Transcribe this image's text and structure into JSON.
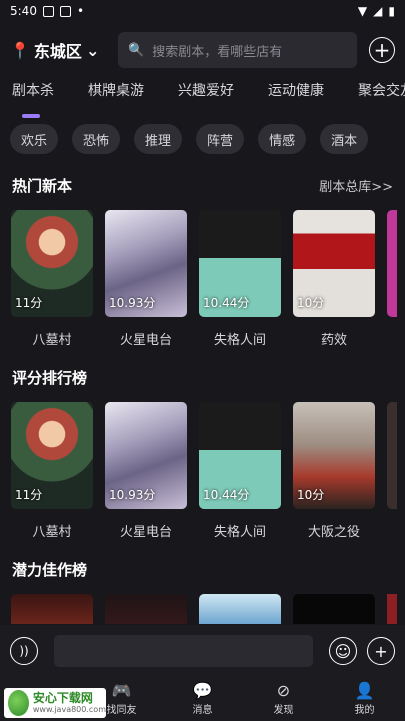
{
  "status_bar": {
    "time": "5:40"
  },
  "header": {
    "location": "东城区",
    "search_placeholder": "搜索剧本，看哪些店有"
  },
  "categories": [
    "剧本杀",
    "棋牌桌游",
    "兴趣爱好",
    "运动健康",
    "聚会交友"
  ],
  "tags": [
    "欢乐",
    "恐怖",
    "推理",
    "阵营",
    "情感",
    "酒本"
  ],
  "sections": {
    "hot": {
      "title": "热门新本",
      "link": "剧本总库>>",
      "items": [
        {
          "score": "11分",
          "title": "八墓村"
        },
        {
          "score": "10.93分",
          "title": "火星电台"
        },
        {
          "score": "10.44分",
          "title": "失格人间"
        },
        {
          "score": "10分",
          "title": "药效"
        }
      ]
    },
    "rank": {
      "title": "评分排行榜",
      "items": [
        {
          "score": "11分",
          "title": "八墓村"
        },
        {
          "score": "10.93分",
          "title": "火星电台"
        },
        {
          "score": "10.44分",
          "title": "失格人间"
        },
        {
          "score": "10分",
          "title": "大阪之役"
        }
      ]
    },
    "potential": {
      "title": "潜力佳作榜"
    }
  },
  "tabbar": {
    "friends": "找同友",
    "messages": "消息",
    "publish": "发现",
    "mine": "我的"
  },
  "watermark": {
    "main": "安心下载网",
    "sub": "www.java800.com"
  }
}
